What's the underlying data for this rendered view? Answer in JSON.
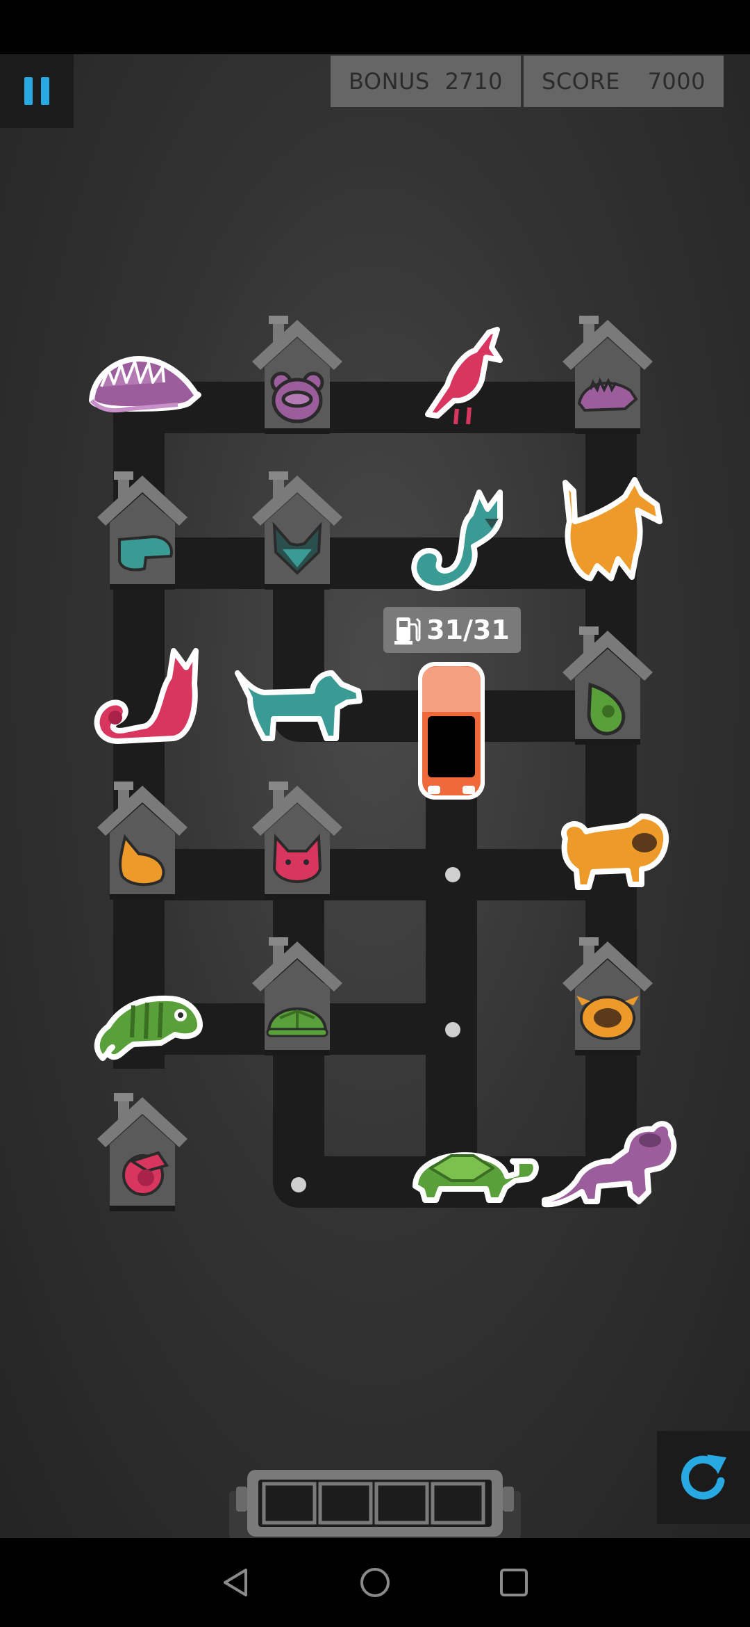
{
  "hud": {
    "bonus_label": "BONUS",
    "bonus_value": "2710",
    "score_label": "SCORE",
    "score_value": "7000"
  },
  "car": {
    "fuel_text": "31/31",
    "fuel_current": 31,
    "fuel_max": 31,
    "color": "#ef6a3a"
  },
  "capacity_tray": {
    "slots_total": 4,
    "slots_filled": 0
  },
  "board": {
    "houses": [
      {
        "animal": "bear",
        "color": "#9c5d9c",
        "icon": "bear-face-icon"
      },
      {
        "animal": "hedgehog",
        "color": "#9c5d9c",
        "icon": "hedgehog-icon"
      },
      {
        "animal": "dachshund",
        "color": "#3a9b94",
        "icon": "dog-head-icon"
      },
      {
        "animal": "fox",
        "color": "#3a9b94",
        "icon": "fox-face-icon"
      },
      {
        "animal": "chameleon",
        "color": "#5aa03a",
        "icon": "chameleon-eye-icon"
      },
      {
        "animal": "fox",
        "color": "#ee9a2a",
        "icon": "fox-face-icon"
      },
      {
        "animal": "cat",
        "color": "#d8355f",
        "icon": "cat-face-icon"
      },
      {
        "animal": "turtle",
        "color": "#5aa03a",
        "icon": "turtle-shell-icon"
      },
      {
        "animal": "pug",
        "color": "#ee9a2a",
        "icon": "pug-face-icon"
      },
      {
        "animal": "cardinal",
        "color": "#d8355f",
        "icon": "bird-head-icon"
      }
    ],
    "animals": [
      {
        "animal": "hedgehog",
        "color": "#9c5d9c"
      },
      {
        "animal": "cardinal",
        "color": "#d8355f"
      },
      {
        "animal": "fox",
        "color": "#3a9b94"
      },
      {
        "animal": "fox",
        "color": "#ee9a2a"
      },
      {
        "animal": "cat",
        "color": "#d8355f"
      },
      {
        "animal": "dachshund",
        "color": "#3a9b94"
      },
      {
        "animal": "pug",
        "color": "#ee9a2a"
      },
      {
        "animal": "chameleon",
        "color": "#5aa03a"
      },
      {
        "animal": "turtle",
        "color": "#5aa03a"
      },
      {
        "animal": "bear",
        "color": "#9c5d9c"
      }
    ]
  },
  "colors": {
    "road": "#1c1c1c",
    "house_roof": "#7a7a7a",
    "house_body": "#5c5c5c",
    "accent": "#29a9e1"
  },
  "nav": {
    "back_icon": "triangle-back-icon",
    "home_icon": "circle-home-icon",
    "recents_icon": "square-recents-icon"
  }
}
